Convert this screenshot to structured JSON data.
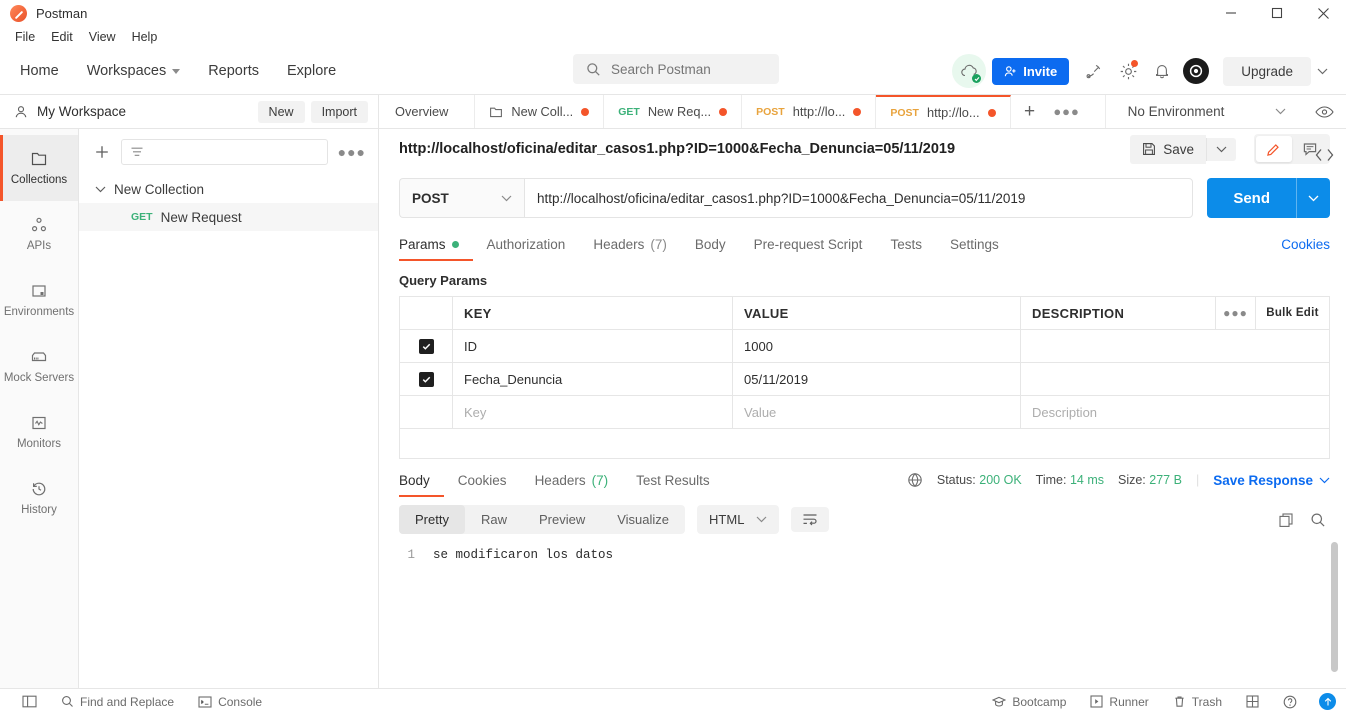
{
  "window": {
    "title": "Postman",
    "minimize_label": "Minimize",
    "maximize_label": "Maximize",
    "close_label": "Close"
  },
  "menubar": {
    "items": [
      "File",
      "Edit",
      "View",
      "Help"
    ]
  },
  "header": {
    "nav": [
      "Home",
      "Workspaces",
      "Reports",
      "Explore"
    ],
    "search_placeholder": "Search Postman",
    "invite_label": "Invite",
    "upgrade_label": "Upgrade"
  },
  "rail": {
    "items": [
      {
        "label": "Collections",
        "icon": "collection-icon",
        "active": true
      },
      {
        "label": "APIs",
        "icon": "apis-icon",
        "active": false
      },
      {
        "label": "Environments",
        "icon": "environments-icon",
        "active": false
      },
      {
        "label": "Mock Servers",
        "icon": "mock-servers-icon",
        "active": false
      },
      {
        "label": "Monitors",
        "icon": "monitors-icon",
        "active": false
      },
      {
        "label": "History",
        "icon": "history-icon",
        "active": false
      }
    ]
  },
  "workspace": {
    "name": "My Workspace",
    "new_label": "New",
    "import_label": "Import"
  },
  "sidebar": {
    "filter_placeholder": "",
    "collection_name": "New Collection",
    "request": {
      "method": "GET",
      "name": "New Request"
    }
  },
  "tabs": [
    {
      "label": "Overview",
      "method": "",
      "unsaved": false,
      "active": false
    },
    {
      "label": "New Coll...",
      "method": "",
      "unsaved": true,
      "active": false
    },
    {
      "label": "New Req...",
      "method": "GET",
      "unsaved": true,
      "active": false
    },
    {
      "label": "http://lo...",
      "method": "POST",
      "unsaved": true,
      "active": false
    },
    {
      "label": "http://lo...",
      "method": "POST",
      "unsaved": true,
      "active": true
    }
  ],
  "environment": {
    "selected": "No Environment"
  },
  "request": {
    "title": "http://localhost/oficina/editar_casos1.php?ID=1000&Fecha_Denuncia=05/11/2019",
    "save_label": "Save",
    "method": "POST",
    "url": "http://localhost/oficina/editar_casos1.php?ID=1000&Fecha_Denuncia=05/11/2019",
    "send_label": "Send",
    "tabs": [
      {
        "label": "Params",
        "badge": "dot",
        "active": true
      },
      {
        "label": "Authorization",
        "badge": "",
        "active": false
      },
      {
        "label": "Headers",
        "badge": "(7)",
        "active": false
      },
      {
        "label": "Body",
        "badge": "",
        "active": false
      },
      {
        "label": "Pre-request Script",
        "badge": "",
        "active": false
      },
      {
        "label": "Tests",
        "badge": "",
        "active": false
      },
      {
        "label": "Settings",
        "badge": "",
        "active": false
      }
    ],
    "cookies_label": "Cookies"
  },
  "params": {
    "section_title": "Query Params",
    "columns": {
      "key": "KEY",
      "value": "VALUE",
      "description": "DESCRIPTION",
      "bulk_edit": "Bulk Edit"
    },
    "rows": [
      {
        "checked": true,
        "key": "ID",
        "value": "1000",
        "description": ""
      },
      {
        "checked": true,
        "key": "Fecha_Denuncia",
        "value": "05/11/2019",
        "description": ""
      }
    ],
    "empty_row": {
      "key": "Key",
      "value": "Value",
      "description": "Description"
    }
  },
  "response": {
    "tabs": [
      {
        "label": "Body",
        "badge": "",
        "active": true
      },
      {
        "label": "Cookies",
        "badge": "",
        "active": false
      },
      {
        "label": "Headers",
        "badge": "(7)",
        "active": false
      },
      {
        "label": "Test Results",
        "badge": "",
        "active": false
      }
    ],
    "status_label": "Status:",
    "status_value": "200 OK",
    "time_label": "Time:",
    "time_value": "14 ms",
    "size_label": "Size:",
    "size_value": "277 B",
    "save_response_label": "Save Response",
    "view_modes": [
      "Pretty",
      "Raw",
      "Preview",
      "Visualize"
    ],
    "active_view_mode": "Pretty",
    "format": "HTML",
    "line_number": "1",
    "body_text": "se modificaron los datos"
  },
  "footer": {
    "find_replace": "Find and Replace",
    "console": "Console",
    "bootcamp": "Bootcamp",
    "runner": "Runner",
    "trash": "Trash",
    "help": "?"
  },
  "colors": {
    "accent_orange": "#f4552a",
    "blue": "#0c8ce9",
    "link_blue": "#0c6bf0",
    "green": "#3cb179",
    "post_orange": "#e8a33d"
  }
}
